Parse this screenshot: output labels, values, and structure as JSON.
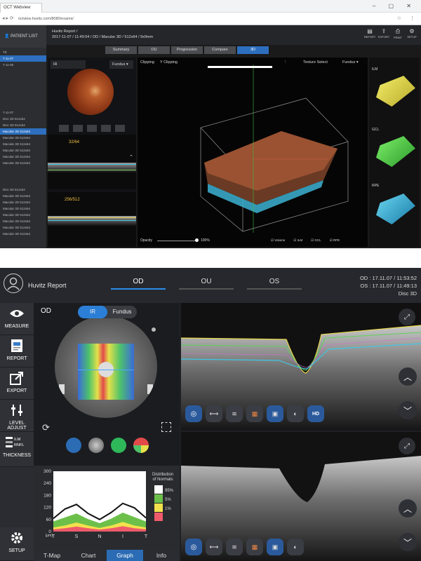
{
  "top_screen": {
    "browser": {
      "tab_title": "OCT Webview",
      "url": "octview.huvitz.com/8080/exams/",
      "window_controls": "– ▢ ✕"
    },
    "sidebar": {
      "patient_list_label": "PATIENT LIST",
      "dates": [
        "TE",
        "7-11-07",
        "7-11-06",
        "7-11-07"
      ],
      "scans_group1": [
        "Disc 3D 512x64",
        "Disc 3D 512x64",
        "Macular 3D 512x64",
        "Macular 3D 512x64",
        "Macular 3D 512x64",
        "Macular 3D 512x64",
        "Macular 3D 512x64",
        "Macular 3D 512x64"
      ],
      "scans_group2": [
        "Disc 3D 512x64",
        "Macular 3D 512x64",
        "Macular 3D 512x64",
        "Macular 3D 512x64",
        "Macular 3D 512x64",
        "Macular 3D 512x64",
        "Macular 3D 512x64",
        "Macular 3D 512x64"
      ]
    },
    "header": {
      "title": "Huvitz Report /",
      "subtitle": "2017-11-07 / 11:49:54 / OD / Macular 3D / 512x64 / 9x9mm",
      "actions": [
        {
          "label": "REPORT",
          "icon": "report-icon"
        },
        {
          "label": "EXPORT",
          "icon": "export-icon"
        },
        {
          "label": "PRINT",
          "icon": "print-icon"
        },
        {
          "label": "SETUP",
          "icon": "gear-icon"
        }
      ]
    },
    "tabs": [
      "Summary",
      "OU",
      "Progression",
      "Compare",
      "3D"
    ],
    "active_tab": "3D",
    "left_viewer": {
      "mode_label": "IR",
      "dropdown_value": "Fundus",
      "bscan1_counter": "32/64",
      "bscan2_counter": "256/512"
    },
    "viewer3d": {
      "clipping_label": "Clipping",
      "yclipping_label": "Y Clipping",
      "texture_label": "Texture Select",
      "texture_value": "Fundus",
      "opacity_label": "Opacity",
      "opacity_value": "100%",
      "layer_checks": [
        "Volume",
        "ILM",
        "GCL",
        "RPE"
      ]
    },
    "layer_thumbs": [
      "ILM",
      "GCL",
      "RPE"
    ]
  },
  "bottom_screen": {
    "brand": "Huvitz Report",
    "eye_tabs": [
      "OD",
      "OU",
      "OS"
    ],
    "active_eye": "OD",
    "datetime_lines": [
      "OD : 17.11.07 / 11:53:52",
      "OS : 17.11.07 / 11:49:13",
      "Disc 3D"
    ],
    "sidebar": [
      {
        "label": "MEASURE",
        "icon": "eye-icon"
      },
      {
        "label": "REPORT",
        "icon": "report-icon"
      },
      {
        "label": "EXPORT",
        "icon": "export-icon"
      },
      {
        "label": "LEVEL ADJUST",
        "icon": "sliders-icon"
      },
      {
        "label": "THICKNESS",
        "icon": "thickness-icon",
        "sub_labels": [
          "ILM",
          "RNFL"
        ]
      },
      {
        "label": "SETUP",
        "icon": "gear-icon"
      }
    ],
    "panel": {
      "eye_label": "OD",
      "toggle_options": [
        "IR",
        "Fundus"
      ],
      "toggle_selected": "IR",
      "bottom_tabs": [
        "T-Map",
        "Chart",
        "Graph",
        "Info"
      ],
      "active_bottom_tab": "Graph"
    },
    "colors": {
      "accent": "#2b7fd6",
      "active_tab": "#2b6cb4"
    }
  },
  "chart_data": {
    "type": "area",
    "title": "",
    "xlabel": "",
    "ylabel": "",
    "y_unit": "(μm)",
    "yticks": [
      0,
      60,
      120,
      180,
      240,
      300
    ],
    "ylim": [
      0,
      300
    ],
    "xticks": [
      "T",
      "S",
      "N",
      "I",
      "T"
    ],
    "legend_title": "Distribution of Normals",
    "legend": [
      {
        "label": "95%",
        "color": "#ffffff"
      },
      {
        "label": "5%",
        "color": "#6cc04a"
      },
      {
        "label": "1%",
        "color": "#f2e14c"
      },
      {
        "label": "",
        "color": "#ee5b6a"
      }
    ],
    "x": [
      0,
      0.125,
      0.25,
      0.375,
      0.5,
      0.625,
      0.75,
      0.875,
      1
    ],
    "band_1pct": [
      20,
      30,
      45,
      30,
      18,
      30,
      48,
      30,
      20
    ],
    "band_5pct": [
      50,
      70,
      90,
      62,
      42,
      64,
      94,
      72,
      50
    ],
    "band_95pct": [
      90,
      128,
      150,
      108,
      80,
      112,
      155,
      132,
      92
    ],
    "measured": [
      65,
      112,
      135,
      90,
      60,
      95,
      140,
      118,
      68
    ]
  }
}
